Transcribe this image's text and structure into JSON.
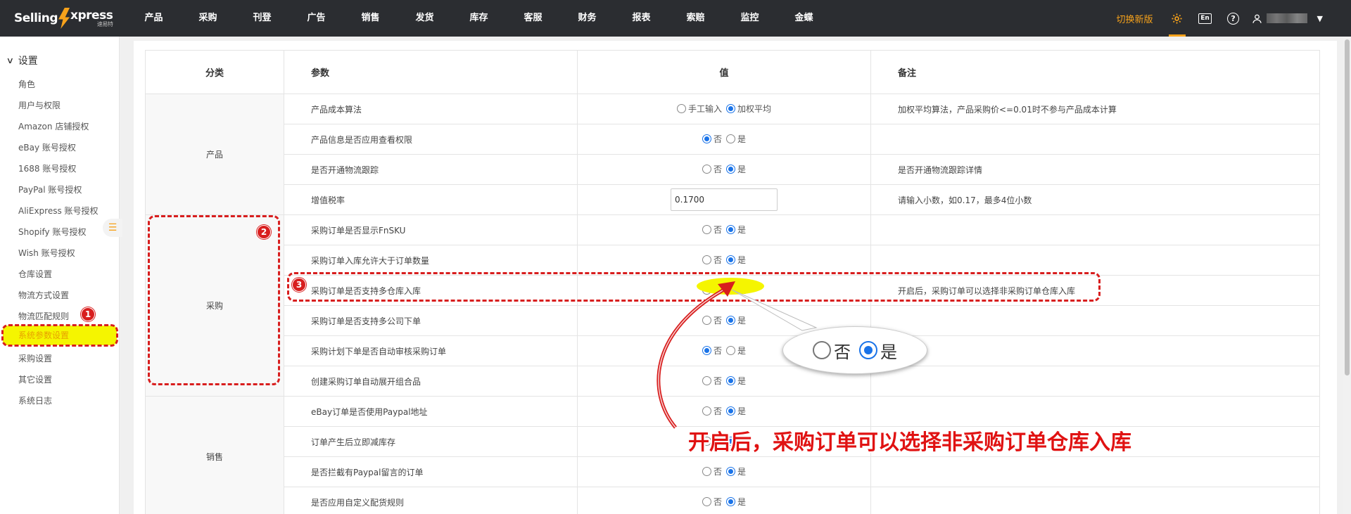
{
  "header": {
    "logo_main": "Selling",
    "logo_tail": "xpress",
    "logo_sub": "速易特",
    "nav": [
      "产品",
      "采购",
      "刊登",
      "广告",
      "销售",
      "发货",
      "库存",
      "客服",
      "财务",
      "报表",
      "索赔",
      "监控",
      "金蝶"
    ],
    "switch_label": "切换新版",
    "icons": [
      "gear-icon",
      "language-en-icon",
      "help-icon",
      "user-icon"
    ],
    "en_label": "En",
    "help_label": "?"
  },
  "sidebar": {
    "section": "设置",
    "items": [
      "角色",
      "用户与权限",
      "Amazon 店铺授权",
      "eBay 账号授权",
      "1688 账号授权",
      "PayPal 账号授权",
      "AliExpress 账号授权",
      "Shopify 账号授权",
      "Wish 账号授权",
      "仓库设置",
      "物流方式设置",
      "物流匹配规则",
      "系统参数设置",
      "采购设置",
      "其它设置",
      "系统日志"
    ],
    "active_index": 12
  },
  "table": {
    "headers": [
      "分类",
      "参数",
      "值",
      "备注"
    ],
    "categories": [
      "产品",
      "采购",
      "销售"
    ],
    "rows": [
      {
        "param": "产品成本算法",
        "options": [
          "手工输入",
          "加权平均"
        ],
        "selected": 1,
        "note": "加权平均算法，产品采购价<=0.01时不参与产品成本计算"
      },
      {
        "param": "产品信息是否应用查看权限",
        "options": [
          "否",
          "是"
        ],
        "selected": 0,
        "note": ""
      },
      {
        "param": "是否开通物流跟踪",
        "options": [
          "否",
          "是"
        ],
        "selected": 1,
        "note": "是否开通物流跟踪详情"
      },
      {
        "param": "增值税率",
        "input_value": "0.1700",
        "note": "请输入小数，如0.17，最多4位小数"
      },
      {
        "param": "采购订单是否显示FnSKU",
        "options": [
          "否",
          "是"
        ],
        "selected": 1,
        "note": ""
      },
      {
        "param": "采购订单入库允许大于订单数量",
        "options": [
          "否",
          "是"
        ],
        "selected": 1,
        "note": ""
      },
      {
        "param": "采购订单是否支持多仓库入库",
        "options": [
          "否",
          "是"
        ],
        "selected": 1,
        "note": "开启后，采购订单可以选择非采购订单仓库入库"
      },
      {
        "param": "采购订单是否支持多公司下单",
        "options": [
          "否",
          "是"
        ],
        "selected": 1,
        "note": ""
      },
      {
        "param": "采购计划下单是否自动审核采购订单",
        "options": [
          "否",
          "是"
        ],
        "selected": 0,
        "note": ""
      },
      {
        "param": "创建采购订单自动展开组合品",
        "options": [
          "否",
          "是"
        ],
        "selected": 1,
        "note": ""
      },
      {
        "param": "eBay订单是否使用Paypal地址",
        "options": [
          "否",
          "是"
        ],
        "selected": 1,
        "note": ""
      },
      {
        "param": "订单产生后立即减库存",
        "options": [
          "否",
          "是"
        ],
        "selected": 1,
        "note": ""
      },
      {
        "param": "是否拦截有Paypal留言的订单",
        "options": [
          "否",
          "是"
        ],
        "selected": 1,
        "note": ""
      },
      {
        "param": "是否应用自定义配货规则",
        "options": [
          "否",
          "是"
        ],
        "selected": 1,
        "note": ""
      }
    ]
  },
  "annotations": {
    "badges": [
      "1",
      "2",
      "3"
    ],
    "zoom_options": [
      "否",
      "是"
    ],
    "zoom_selected": 1,
    "callout": "开启后，采购订单可以选择非采购订单仓库入库",
    "colors": {
      "red": "#d81e1e",
      "yellow": "#f5f500",
      "accent": "#f7a21b",
      "radio": "#1a73e8"
    }
  }
}
